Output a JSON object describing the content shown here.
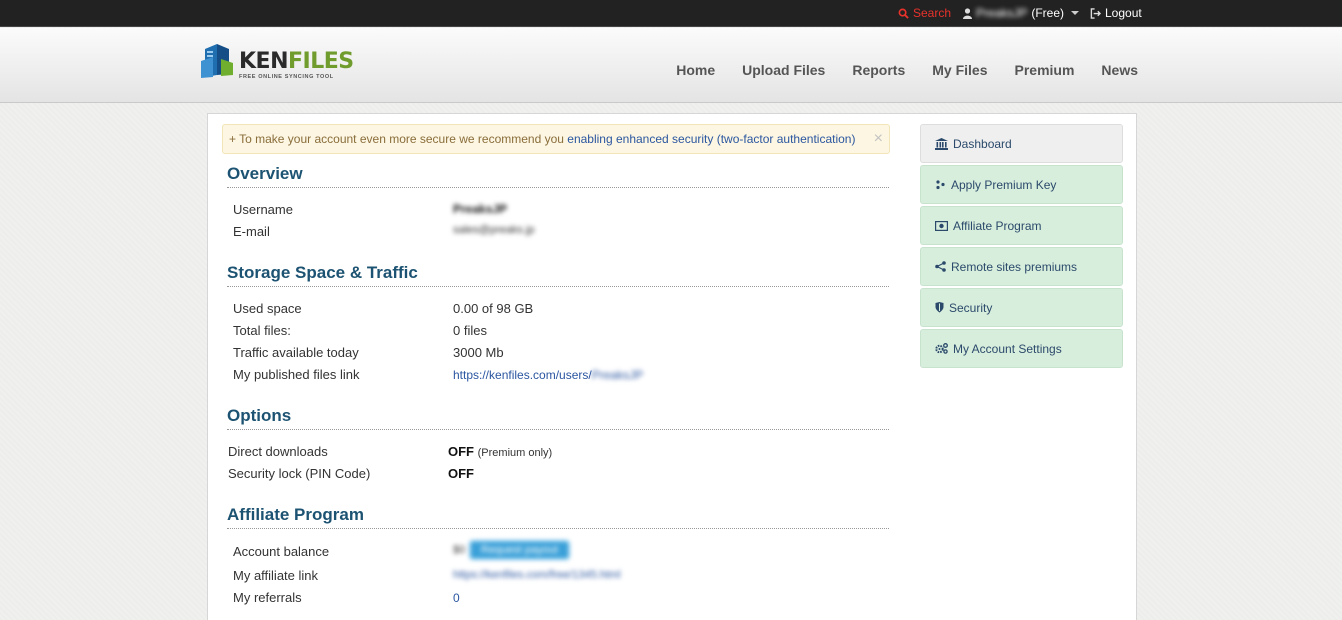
{
  "topbar": {
    "search_label": "Search",
    "username": "PreaksJP",
    "plan": "(Free)",
    "logout_label": "Logout"
  },
  "logo": {
    "name_part1": "KEN",
    "name_part2": "FILES",
    "tagline": "FREE ONLINE SYNCING TOOL"
  },
  "nav": [
    "Home",
    "Upload Files",
    "Reports",
    "My Files",
    "Premium",
    "News"
  ],
  "alert": {
    "prefix": "+ To make your account even more secure we recommend you ",
    "link": "enabling enhanced security",
    "suffix": " (two-factor authentication)",
    "close": "×"
  },
  "overview": {
    "title": "Overview",
    "username_label": "Username",
    "username_value": "PreaksJP",
    "email_label": "E-mail",
    "email_value": "sales@preaks.jp"
  },
  "storage": {
    "title": "Storage Space & Traffic",
    "used_label": "Used space",
    "used_value": "0.00 of 98 GB",
    "files_label": "Total files:",
    "files_value": "0 files",
    "traffic_label": "Traffic available today",
    "traffic_value": "3000 Mb",
    "link_label": "My published files link",
    "link_value": "https://kenfiles.com/users/",
    "link_user": "PreaksJP"
  },
  "options": {
    "title": "Options",
    "direct_label": "Direct downloads",
    "direct_value": "OFF",
    "direct_note": "(Premium only)",
    "lock_label": "Security lock (PIN Code)",
    "lock_value": "OFF"
  },
  "affiliate": {
    "title": "Affiliate Program",
    "balance_label": "Account balance",
    "balance_value": "$0",
    "balance_button": "Request payout",
    "aff_link_label": "My affiliate link",
    "aff_link_value": "https://kenfiles.com/free/1345.html",
    "referrals_label": "My referrals",
    "referrals_value": "0"
  },
  "sidebar": [
    {
      "label": "Dashboard",
      "icon": "bank-icon"
    },
    {
      "label": "Apply Premium Key",
      "icon": "key-icon"
    },
    {
      "label": "Affiliate Program",
      "icon": "money-icon"
    },
    {
      "label": "Remote sites premiums",
      "icon": "share-icon"
    },
    {
      "label": "Security",
      "icon": "shield-icon"
    },
    {
      "label": "My Account Settings",
      "icon": "gears-icon"
    }
  ],
  "colors": {
    "accent": "#1d5372",
    "sidebar_bg": "#d8eedd",
    "search": "#e8322b"
  }
}
